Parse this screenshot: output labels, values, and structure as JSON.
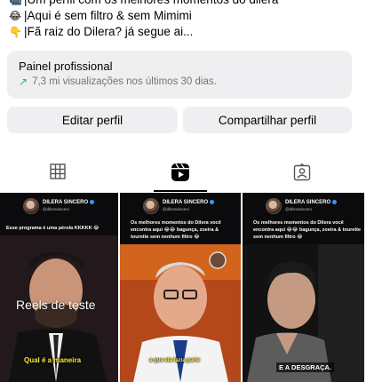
{
  "bio": {
    "lines": [
      {
        "icon": "camera-icon",
        "glyph": "📹",
        "text": "|Um perfil com os melhores momentos do dilera"
      },
      {
        "icon": "laughing-emoji-icon",
        "glyph": "😂",
        "text": "|Aqui é sem filtro & sem Mimimi"
      },
      {
        "icon": "pointing-hand-icon",
        "glyph": "👇",
        "text": "|Fã raiz do Dilera? já segue ai..."
      }
    ]
  },
  "panel": {
    "title": "Painel profissional",
    "subtitle": "7,3 mi visualizações nos últimos 30 dias.",
    "trend_icon": "trend-up-icon",
    "trend_color": "#2fb36b"
  },
  "buttons": {
    "edit": "Editar perfil",
    "share": "Compartilhar perfil"
  },
  "tabs": [
    {
      "name": "grid",
      "icon": "grid-icon"
    },
    {
      "name": "reels",
      "icon": "reels-icon",
      "active": true
    },
    {
      "name": "tagged",
      "icon": "tagged-icon"
    }
  ],
  "reels": [
    {
      "account": "DILERA SINCERO",
      "handle": "@dilerasincero",
      "caption": "Esse programa é uma pérola KKKKK 😂",
      "overlay_title": "Reels de teste",
      "subtitle": "Qual é a maneira"
    },
    {
      "account": "DILERA SINCERO",
      "handle": "@dilerasincero",
      "caption": "Os melhores momentos do Dilera você encontra aqui 😂😂 bagunça, zoeira & tourette sem nenhum filtro 😂",
      "subtitle": "a que ela fazia parte"
    },
    {
      "account": "DILERA SINCERO",
      "handle": "@dilerasincero",
      "caption": "Os melhores momentos do Dilera você encontra aqui 😂😂 bagunça, zoeira & tourette sem nenhum filtro 😂",
      "subtitle": "E A DESGRAÇA."
    }
  ],
  "colors": {
    "panel_bg": "#efeff1",
    "verified": "#3897f0",
    "subtitle_yellow": "#ffeb3b"
  }
}
